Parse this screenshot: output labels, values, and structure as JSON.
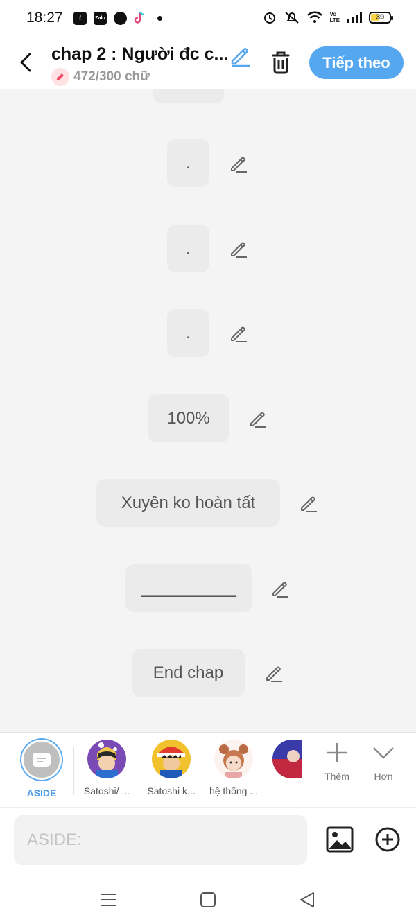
{
  "status_bar": {
    "time": "18:27",
    "left_icons": [
      "facebook-icon",
      "zalo-icon",
      "messenger-icon",
      "tiktok-icon",
      "dot-icon"
    ],
    "zalo_text": "Zalo",
    "right_icons": [
      "alarm-icon",
      "mute-icon",
      "wifi-icon",
      "volte-icon",
      "signal-icon",
      "battery-icon"
    ],
    "volte_text": "Vo\nLTE",
    "battery_level": "39",
    "battery_fill_fraction": 0.39
  },
  "header": {
    "title": "chap 2 : Người đc c...",
    "word_count": "472/300 chữ",
    "next_label": "Tiếp theo",
    "accent_color": "#55a7f0"
  },
  "messages": [
    {
      "text": "."
    },
    {
      "text": "."
    },
    {
      "text": "."
    },
    {
      "text": "100%"
    },
    {
      "text": "Xuyên ko hoàn tất"
    },
    {
      "text": "___________"
    },
    {
      "text": "End chap"
    }
  ],
  "characters": {
    "aside_label": "ASIDE",
    "items": [
      {
        "label": "Satoshi/ ..."
      },
      {
        "label": "Satoshi k..."
      },
      {
        "label": "hệ thống ..."
      },
      {
        "label": ""
      }
    ],
    "add_label": "Thêm",
    "more_label": "Hơn"
  },
  "input": {
    "placeholder": "ASIDE:"
  }
}
